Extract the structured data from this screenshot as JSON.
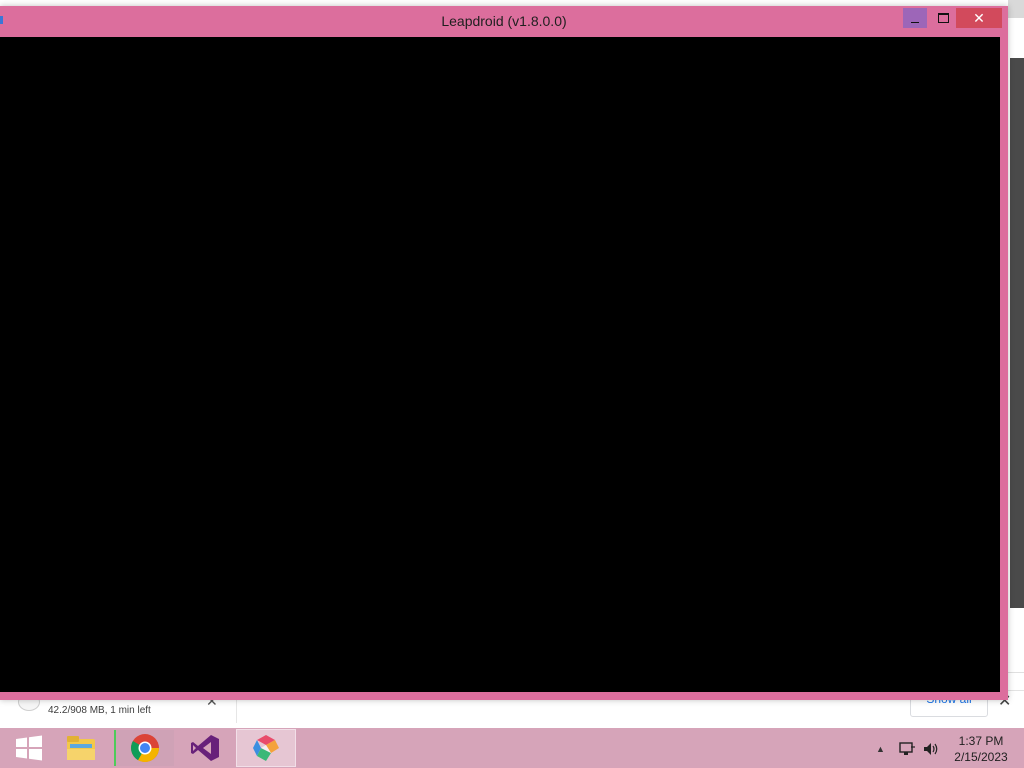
{
  "window": {
    "title": "Leapdroid (v1.8.0.0)"
  },
  "download_bar": {
    "status": "42.2/908 MB, 1 min left",
    "show_all_label": "Show all"
  },
  "taskbar": {
    "apps": [
      {
        "name": "Start",
        "icon": "windows-logo-icon"
      },
      {
        "name": "File Explorer",
        "icon": "folder-icon"
      },
      {
        "name": "Google Chrome",
        "icon": "chrome-icon"
      },
      {
        "name": "Visual Studio",
        "icon": "visual-studio-icon"
      },
      {
        "name": "Leapdroid",
        "icon": "leapdroid-icon",
        "active": true
      }
    ],
    "clock": {
      "time": "1:37 PM",
      "date": "2/15/2023"
    }
  },
  "colors": {
    "window_frame": "#dc6e9d",
    "taskbar": "#d6a4b9",
    "close_button": "#d24a5c",
    "minimize_button": "#9d66b8",
    "screen": "#000000"
  }
}
